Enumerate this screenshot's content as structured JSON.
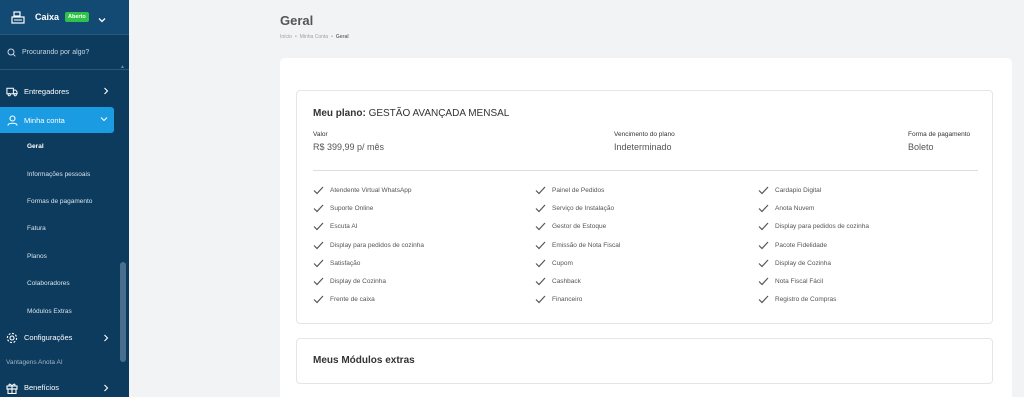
{
  "sidebar": {
    "store_name": "Caixa",
    "store_status": "Aberto",
    "search_placeholder": "Procurando por algo?",
    "items": {
      "entregadores": "Entregadores",
      "minha_conta": "Minha conta",
      "configuracoes": "Configurações",
      "beneficios": "Benefícios"
    },
    "sub_items": [
      "Geral",
      "Informações pessoais",
      "Formas de pagamento",
      "Fatura",
      "Planos",
      "Colaboradores",
      "Módulos Extras"
    ],
    "section_label": "Vantagens Anota AI"
  },
  "page": {
    "title": "Geral",
    "breadcrumb": [
      "Início",
      "Minha Conta",
      "Geral"
    ],
    "breadcrumb_sep": "•"
  },
  "plan": {
    "title_prefix": "Meu plano:",
    "title_name": "GESTÃO AVANÇADA MENSAL",
    "valor_label": "Valor",
    "valor_value": "R$ 399,99 p/ mês",
    "vencimento_label": "Vencimento do plano",
    "vencimento_value": "Indeterminado",
    "pagamento_label": "Forma de pagamento",
    "pagamento_value": "Boleto",
    "features_col1": [
      "Atendente Virtual WhatsApp",
      "Suporte Online",
      "Escuta AI",
      "Display para pedidos de cozinha",
      "Satisfação",
      "Display de Cozinha",
      "Frente de caixa"
    ],
    "features_col2": [
      "Painel de Pedidos",
      "Serviço de Instalação",
      "Gestor de Estoque",
      "Emissão de Nota Fiscal",
      "Cupom",
      "Cashback",
      "Financeiro"
    ],
    "features_col3": [
      "Cardapio Digital",
      "Anota Nuvem",
      "Display para pedidos de cozinha",
      "Pacote Fidelidade",
      "Display de Cozinha",
      "Nota Fiscal Fácil",
      "Registro de Compras"
    ]
  },
  "modules": {
    "title": "Meus Módulos extras"
  },
  "colors": {
    "sidebar_bg": "#0c3b5e",
    "active_item": "#1a9be2",
    "badge_green": "#2fc24a"
  }
}
